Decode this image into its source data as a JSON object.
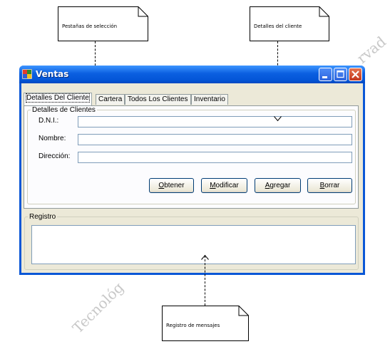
{
  "annotations": {
    "tabs": "Pestañas de selección",
    "client_details": "Detalles del cliente",
    "log": "Registro de mensajes"
  },
  "watermark": [
    "rvad",
    "Tecnológ"
  ],
  "window": {
    "title": "Ventas",
    "controls": [
      "minimize-icon",
      "maximize-icon",
      "close-icon"
    ]
  },
  "tabs": [
    {
      "label": "Detalles Del Cliente",
      "active": true
    },
    {
      "label": "Cartera",
      "active": false
    },
    {
      "label": "Todos Los Clientes",
      "active": false
    },
    {
      "label": "Inventario",
      "active": false
    }
  ],
  "client_group": {
    "title": "Detalles de Clientes",
    "fields": [
      {
        "label": "D.N.I.:",
        "value": ""
      },
      {
        "label": "Nombre:",
        "value": ""
      },
      {
        "label": "Dirección:",
        "value": ""
      }
    ]
  },
  "buttons": [
    {
      "mnemonic": "O",
      "rest": "btener"
    },
    {
      "mnemonic": "M",
      "rest": "odificar"
    },
    {
      "mnemonic": "A",
      "rest": "gregar"
    },
    {
      "mnemonic": "B",
      "rest": "orrar"
    }
  ],
  "log_group": {
    "title": "Registro",
    "content": ""
  },
  "colors": {
    "title_bar": "#0456d8",
    "window_face": "#ece9d8",
    "close_button": "#c2361d"
  }
}
